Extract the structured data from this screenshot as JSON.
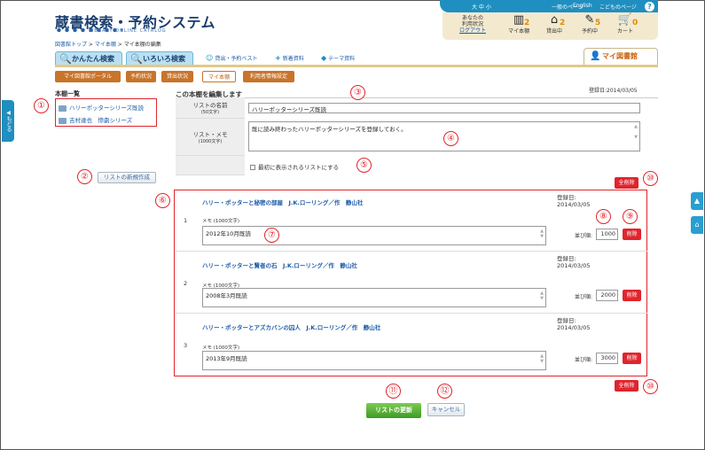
{
  "header": {
    "logo": "蔵書検索・予約システム",
    "logo_sub": "LIBRARY ONLINE CATALOG",
    "top_links": {
      "size": "大 中 小",
      "general": "一般のページ",
      "english": "English",
      "kids": "こどものページ",
      "help": "?"
    },
    "user_status": "あなたの\n利用状況\nログアウト",
    "user_status_l1": "あなたの",
    "user_status_l2": "利用状況",
    "logout": "ログアウト",
    "counters": [
      {
        "label": "マイ本棚",
        "count": "2",
        "icon": "bookshelf-icon"
      },
      {
        "label": "貸出中",
        "count": "2",
        "icon": "house-icon"
      },
      {
        "label": "予約中",
        "count": "5",
        "icon": "reserve-icon"
      },
      {
        "label": "カート",
        "count": "0",
        "icon": "cart-icon"
      }
    ]
  },
  "breadcrumb": {
    "top": "図書館トップ",
    "sep1": " > ",
    "shelf": "マイ本棚",
    "sep2": " > ",
    "current": "マイ本棚の編集"
  },
  "tabs": {
    "easy": "かんたん検索",
    "various": "いろいろ検索",
    "best": "貸出・予約ベスト",
    "new": "新着資料",
    "theme": "テーマ資料",
    "mylib": "マイ図書館"
  },
  "subtabs": [
    "マイ図書館ポータル",
    "予約状況",
    "貸出状況",
    "マイ本棚",
    "利用者情報設定"
  ],
  "side": {
    "back": "もどる"
  },
  "left": {
    "heading": "本棚一覧",
    "items": [
      "ハリーポッターシリーズ既読",
      "吉村達也　惨劇シリーズ"
    ],
    "new_button": "リストの新規作成"
  },
  "edit": {
    "heading": "この本棚を編集します",
    "reg_date": "登録日:2014/03/05",
    "name_label": "リストの名前",
    "name_sub": "(50文字)",
    "name_value": "ハリーポッターシリーズ既読",
    "memo_label": "リスト・メモ",
    "memo_sub": "(1000文字)",
    "memo_value": "既に読み終わったハリーポッターシリーズを登録しておく。",
    "checkbox_label": "最初に表示されるリストにする",
    "delete_all": "全削除"
  },
  "books": [
    {
      "no": "1",
      "title": "ハリー・ポッターと秘密の部屋　J.K.ローリング／作　静山社",
      "reg_label": "登録日:",
      "reg_date": "2014/03/05",
      "memo_label": "メモ (1000文字)",
      "memo": "2012年10月既読",
      "order_label": "並び順:",
      "order": "1000",
      "del": "削除"
    },
    {
      "no": "2",
      "title": "ハリー・ポッターと賢者の石　J.K.ローリング／作　静山社",
      "reg_label": "登録日:",
      "reg_date": "2014/03/05",
      "memo_label": "メモ (1000文字)",
      "memo": "2008年3月既読",
      "order_label": "並び順:",
      "order": "2000",
      "del": "削除"
    },
    {
      "no": "3",
      "title": "ハリー・ポッターとアズカバンの囚人　J.K.ローリング／作　静山社",
      "reg_label": "登録日:",
      "reg_date": "2014/03/05",
      "memo_label": "メモ (1000文字)",
      "memo": "2013年9月既読",
      "order_label": "並び順:",
      "order": "3000",
      "del": "削除"
    }
  ],
  "actions": {
    "update": "リストの更新",
    "cancel": "キャンセル"
  },
  "callouts": [
    "①",
    "②",
    "③",
    "④",
    "⑤",
    "⑥",
    "⑦",
    "⑧",
    "⑨",
    "⑩",
    "⑪",
    "⑫"
  ],
  "colors": {
    "accent": "#1e8fc0",
    "callout": "#e0242c",
    "update": "#4caf2e"
  }
}
